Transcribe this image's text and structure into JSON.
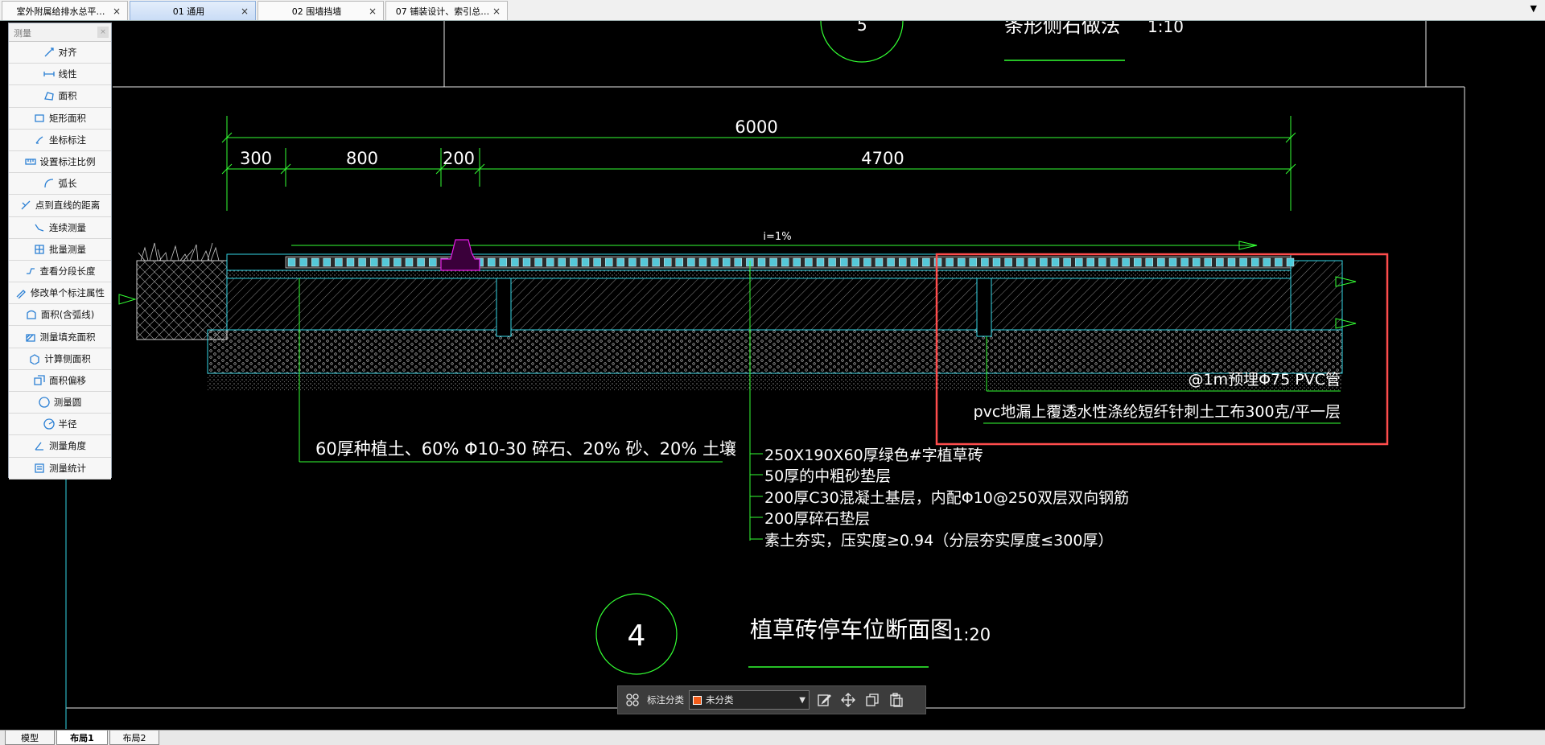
{
  "tabs": [
    {
      "label": "室外附属给排水总平…",
      "active": false
    },
    {
      "label": "01  通用",
      "active": true
    },
    {
      "label": "02  围墙挡墙",
      "active": false
    },
    {
      "label": "07  铺装设计、索引总…",
      "active": false
    }
  ],
  "close_glyph": "×",
  "menu_arrow": "▼",
  "measure_panel": {
    "title": "测量",
    "items": [
      {
        "label": "对齐",
        "icon": "align-icon"
      },
      {
        "label": "线性",
        "icon": "linear-icon"
      },
      {
        "label": "面积",
        "icon": "area-icon"
      },
      {
        "label": "矩形面积",
        "icon": "rect-area-icon"
      },
      {
        "label": "坐标标注",
        "icon": "coordinate-icon"
      },
      {
        "label": "设置标注比例",
        "icon": "scale-icon"
      },
      {
        "label": "弧长",
        "icon": "arc-icon"
      },
      {
        "label": "点到直线的距离",
        "icon": "point-line-icon"
      },
      {
        "label": "连续测量",
        "icon": "continuous-icon"
      },
      {
        "label": "批量测量",
        "icon": "batch-icon"
      },
      {
        "label": "查看分段长度",
        "icon": "segment-icon"
      },
      {
        "label": "修改单个标注属性",
        "icon": "edit-dim-icon"
      },
      {
        "label": "面积(含弧线)",
        "icon": "arc-area-icon"
      },
      {
        "label": "测量填充面积",
        "icon": "fill-area-icon"
      },
      {
        "label": "计算侧面积",
        "icon": "side-area-icon"
      },
      {
        "label": "面积偏移",
        "icon": "offset-icon"
      },
      {
        "label": "测量圆",
        "icon": "circle-icon"
      },
      {
        "label": "半径",
        "icon": "radius-icon"
      },
      {
        "label": "测量角度",
        "icon": "angle-icon"
      },
      {
        "label": "测量统计",
        "icon": "stats-icon"
      }
    ]
  },
  "drawing": {
    "top_title": "条形侧石做法",
    "top_scale": "1:10",
    "dim_total": "6000",
    "dim_segments": [
      "300",
      "800",
      "200",
      "4700"
    ],
    "slope": "i=1%",
    "note_soil": "60厚种植土、60% Φ10-30 碎石、20% 砂、20% 土壤",
    "note_pipe": "@1m预埋Φ75 PVC管",
    "note_geotextile": "pvc地漏上覆透水性涤纶短纤针刺土工布300克/平一层",
    "layers": [
      "250X190X60厚绿色#字植草砖",
      "50厚的中粗砂垫层",
      "200厚C30混凝土基层，内配Φ10@250双层双向钢筋",
      "200厚碎石垫层",
      "素土夯实，压实度≥0.94（分层夯实厚度≤300厚）"
    ],
    "detail_number": "4",
    "detail_title": "植草砖停车位断面图",
    "detail_scale": "1:20"
  },
  "colors": {
    "line_green": "#33ff33",
    "cyan": "#33d6e6",
    "white": "#ffffff",
    "magenta": "#e61ee6",
    "highlight_red": "#ff4d4d",
    "frame": "#e6e6e6"
  },
  "annotation_toolbar": {
    "grid_icon": "grid-icon",
    "label": "标注分类",
    "selected_category": "未分类",
    "swatch_color": "#f25c1a",
    "buttons": [
      "edit-icon",
      "move-icon",
      "copy-icon",
      "paste-icon"
    ]
  },
  "layout_tabs": [
    {
      "label": "模型",
      "active": false
    },
    {
      "label": "布局1",
      "active": true
    },
    {
      "label": "布局2",
      "active": false
    }
  ]
}
